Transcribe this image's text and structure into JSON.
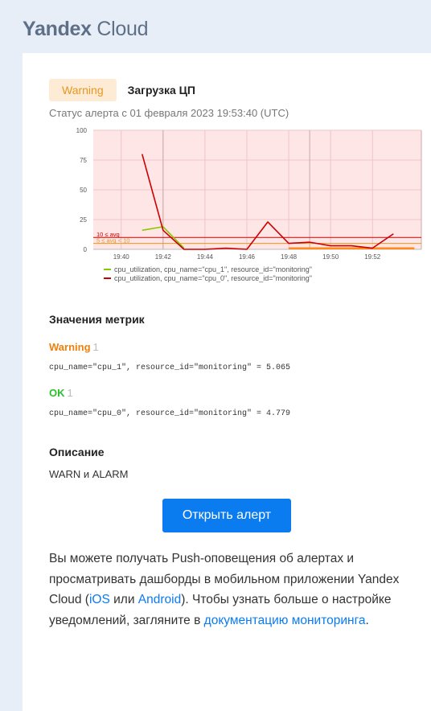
{
  "brand": {
    "logo_main": "Yandex",
    "logo_sub": "Cloud"
  },
  "alert": {
    "badge": "Warning",
    "title": "Загрузка ЦП",
    "status": "Статус алерта с 01 февраля 2023 19:53:40 (UTC)"
  },
  "chart_data": {
    "type": "line",
    "y_ticks": [
      "0",
      "25",
      "50",
      "75",
      "100"
    ],
    "ylim": [
      0,
      100
    ],
    "x_ticks": [
      "19:40",
      "19:42",
      "19:44",
      "19:46",
      "19:48",
      "19:50",
      "19:52"
    ],
    "xlim": [
      "19:38:40",
      "19:54:20"
    ],
    "grid": true,
    "series": [
      {
        "name": "cpu_utilization, cpu_name=\"cpu_1\", resource_id=\"monitoring\"",
        "color": "#88c800",
        "x": [
          "19:41",
          "19:42",
          "19:43"
        ],
        "y": [
          16,
          19,
          1
        ]
      },
      {
        "name": "cpu_utilization, cpu_name=\"cpu_0\", resource_id=\"monitoring\"",
        "color": "#cc0000",
        "x": [
          "19:41",
          "19:42",
          "19:43",
          "19:44",
          "19:45",
          "19:46",
          "19:47",
          "19:48",
          "19:49",
          "19:50",
          "19:51",
          "19:52",
          "19:53"
        ],
        "y": [
          80,
          16,
          0,
          0,
          1,
          0,
          23,
          5,
          6,
          3,
          3,
          1,
          13
        ]
      }
    ],
    "thresholds": [
      {
        "label": "10 ≤ avg",
        "value": 10,
        "color": "#cc0000"
      },
      {
        "label": "5 ≤ avg < 10",
        "value": 5,
        "color": "#e8971e"
      }
    ],
    "alert_band": {
      "from": "19:48",
      "to": "19:54",
      "color": "#ff8c1a"
    }
  },
  "metrics": {
    "heading": "Значения метрик",
    "warning_label": "Warning",
    "warning_count": "1",
    "warning_value": "cpu_name=\"cpu_1\", resource_id=\"monitoring\" = 5.065",
    "ok_label": "OK",
    "ok_count": "1",
    "ok_value": "cpu_name=\"cpu_0\", resource_id=\"monitoring\" = 4.779"
  },
  "description": {
    "heading": "Описание",
    "text": "WARN и ALARM"
  },
  "open_button": "Открыть алерт",
  "info": {
    "part1": "Вы можете получать Push-оповещения об алертах и просматривать дашборды в мобильном приложении Yandex Cloud (",
    "ios": "iOS",
    "part2": " или ",
    "android": "Android",
    "part3": "). Чтобы узнать больше о настройке уведомлений, загляните в ",
    "docs_link": "документацию мониторинга",
    "part4": "."
  },
  "colors": {
    "accent": "#0b7bf0",
    "warning": "#e8971e",
    "ok": "#2bc12b",
    "chart_bg": "#ffe6e6"
  }
}
